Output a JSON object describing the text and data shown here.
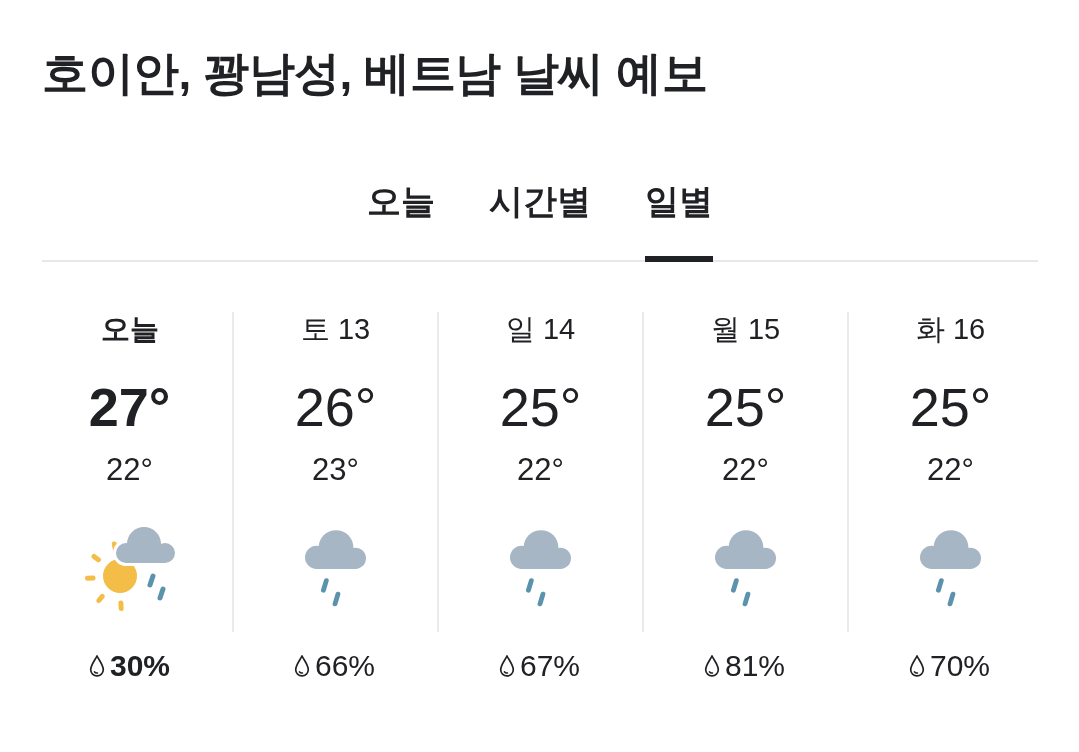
{
  "title": "호이안, 꽝남성, 베트남 날씨 예보",
  "tabs": [
    {
      "label": "오늘",
      "selected": false
    },
    {
      "label": "시간별",
      "selected": false
    },
    {
      "label": "일별",
      "selected": true
    }
  ],
  "days": [
    {
      "day": "오늘",
      "selected": true,
      "high": "27°",
      "low": "22°",
      "kind": "sun-rain",
      "precip": "30%"
    },
    {
      "day": "토 13",
      "selected": false,
      "high": "26°",
      "low": "23°",
      "kind": "rain",
      "precip": "66%"
    },
    {
      "day": "일 14",
      "selected": false,
      "high": "25°",
      "low": "22°",
      "kind": "rain",
      "precip": "67%"
    },
    {
      "day": "월 15",
      "selected": false,
      "high": "25°",
      "low": "22°",
      "kind": "rain",
      "precip": "81%"
    },
    {
      "day": "화 16",
      "selected": false,
      "high": "25°",
      "low": "22°",
      "kind": "rain",
      "precip": "70%"
    }
  ]
}
